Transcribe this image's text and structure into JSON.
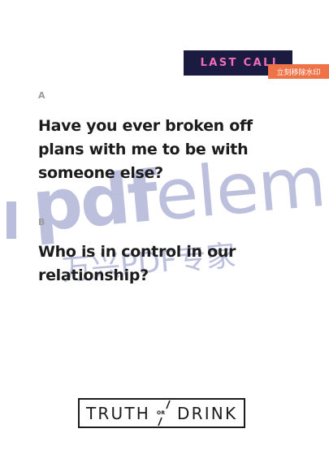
{
  "card": {
    "badge": "LAST CALL",
    "questions": [
      {
        "letter": "A",
        "text": "Have you ever broken off plans with me to be with someone else?"
      },
      {
        "letter": "B",
        "text": "Who is in control in our relationship?"
      }
    ]
  },
  "logo": {
    "word_left": "TRUTH",
    "word_mid": "OR",
    "word_right": "DRINK"
  },
  "watermark": {
    "tag": "立刻移除水印",
    "brand_pdf": "pdf",
    "brand_rest": "eleme",
    "brand_cn": "万兴PDF专家"
  },
  "colors": {
    "badge_bg": "#1b1a40",
    "badge_text": "#f06eb7",
    "watermark_tag": "#ef7346",
    "watermark_brand": "#5f69af"
  }
}
